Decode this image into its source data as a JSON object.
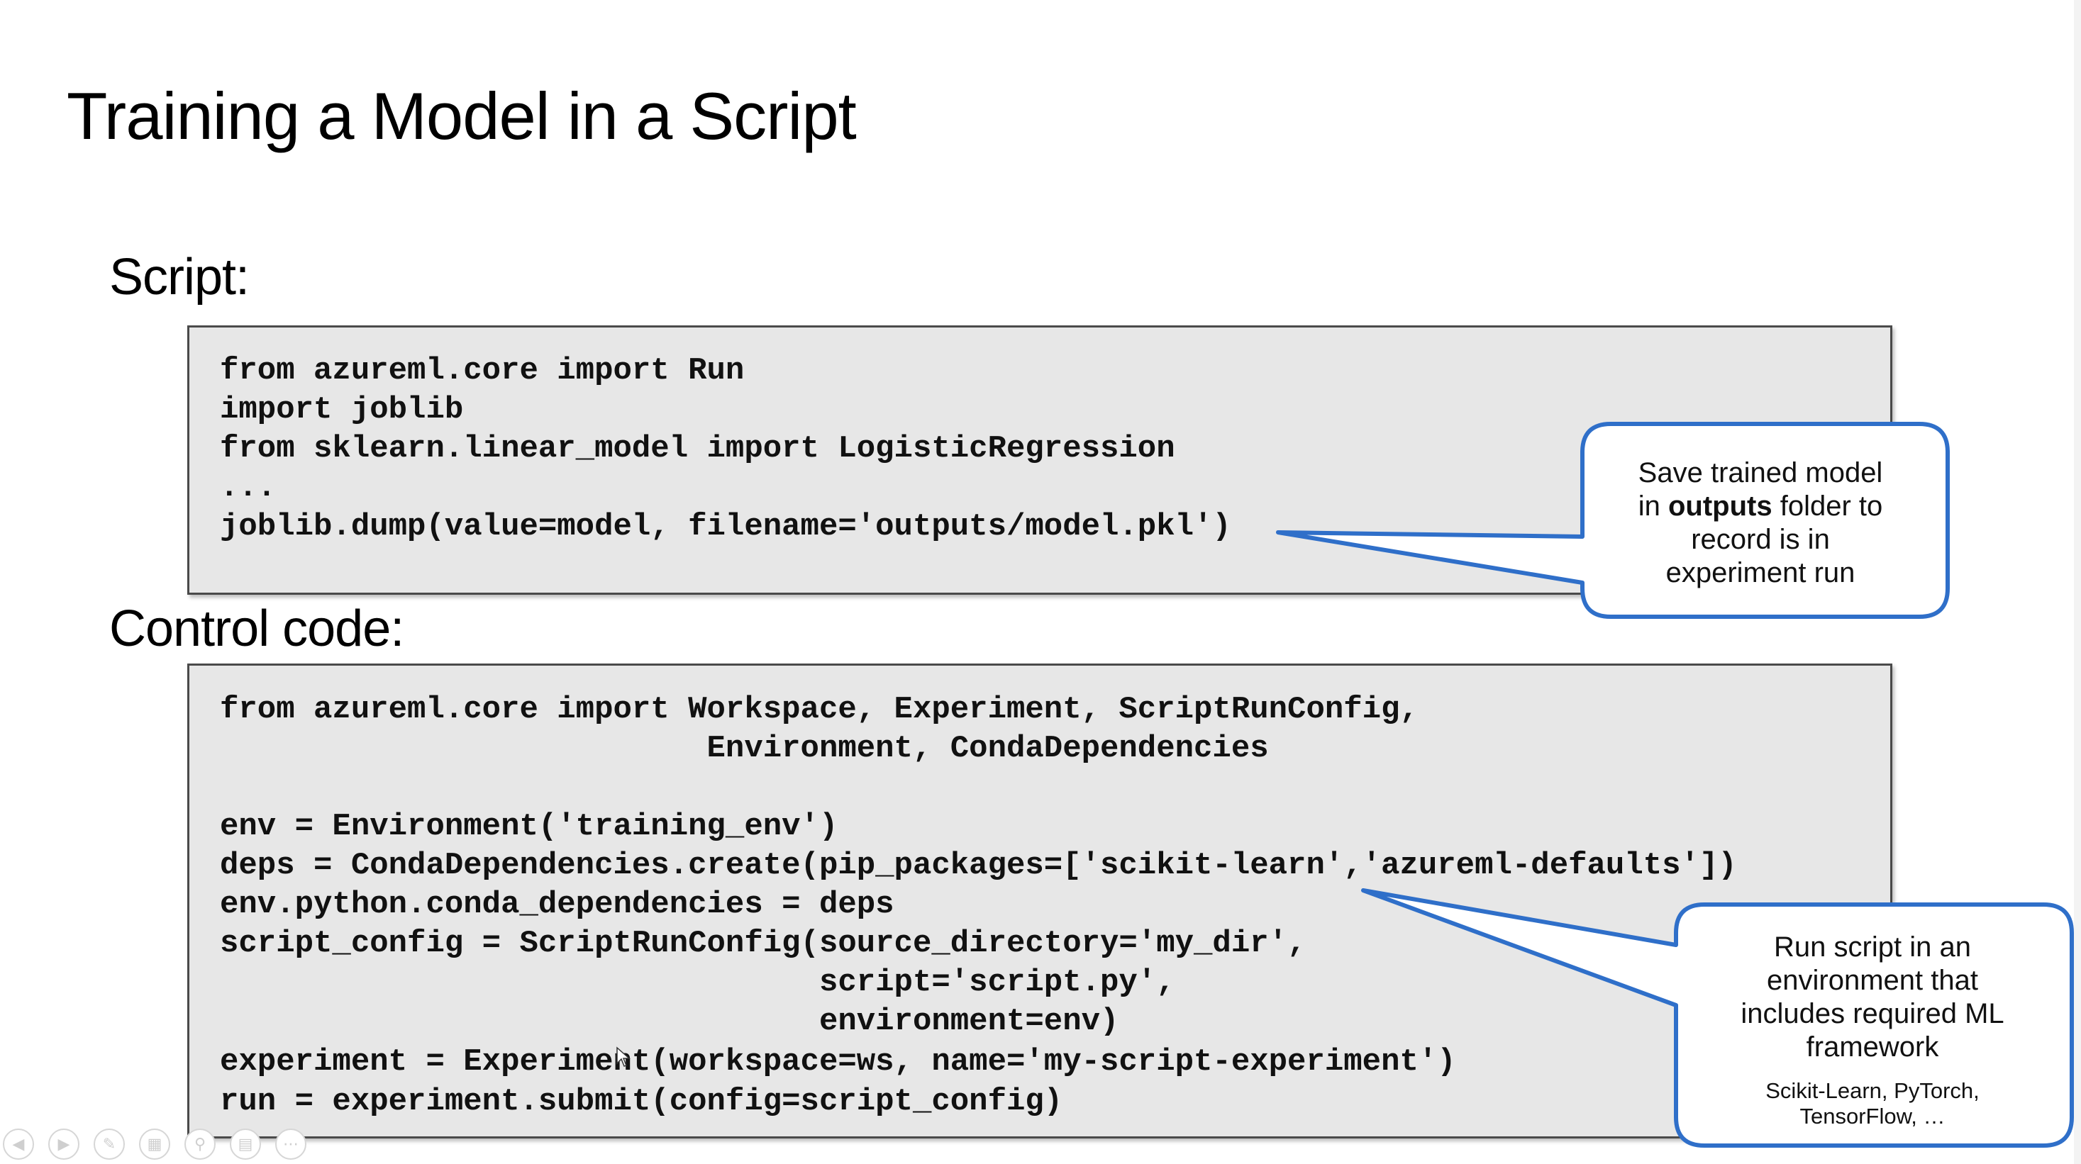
{
  "slide": {
    "title": "Training a Model in a Script",
    "script_section": {
      "label": "Script:",
      "lines": [
        "from azureml.core import Run",
        "import joblib",
        "from sklearn.linear_model import LogisticRegression",
        "...",
        "joblib.dump(value=model, filename='outputs/model.pkl')"
      ]
    },
    "control_section": {
      "label": "Control code:",
      "lines": [
        "from azureml.core import Workspace, Experiment, ScriptRunConfig,",
        "                          Environment, CondaDependencies",
        "",
        "env = Environment('training_env')",
        "deps = CondaDependencies.create(pip_packages=['scikit-learn','azureml-defaults'])",
        "env.python.conda_dependencies = deps",
        "script_config = ScriptRunConfig(source_directory='my_dir',",
        "                                script='script.py',",
        "                                environment=env)",
        "experiment = Experiment(workspace=ws, name='my-script-experiment')",
        "run = experiment.submit(config=script_config)"
      ]
    },
    "callouts": {
      "outputs": {
        "line1": "Save trained model",
        "line2_pre": "in ",
        "line2_bold": "outputs",
        "line2_post": " folder to",
        "line3": "record is in",
        "line4": "experiment run"
      },
      "environment": {
        "line1": "Run script in an",
        "line2": "environment that",
        "line3": "includes required ML",
        "line4": "framework",
        "note1": "Scikit-Learn, PyTorch,",
        "note2": "TensorFlow, …"
      }
    },
    "colors": {
      "accent": "#2f6fc9",
      "code_background": "#e7e7e7",
      "code_border": "#4a4a4a"
    }
  },
  "toolbar": {
    "icons": [
      "previous-icon",
      "next-icon",
      "pen-icon",
      "slides-icon",
      "zoom-icon",
      "subtitles-icon",
      "more-icon"
    ]
  }
}
